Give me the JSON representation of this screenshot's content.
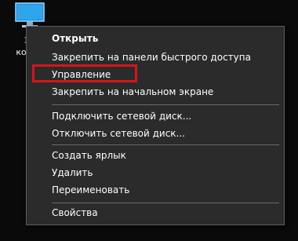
{
  "desktop": {
    "icon_name": "monitor-icon",
    "icon_label_line1": "Эт",
    "icon_label_line2": "компь"
  },
  "context_menu": {
    "items": [
      {
        "label": "Открыть",
        "default": true
      },
      {
        "label": "Закрепить на панели быстрого доступа"
      },
      {
        "label": "Управление",
        "highlighted": true
      },
      {
        "label": "Закрепить на начальном экране"
      },
      {
        "label": "Подключить сетевой диск..."
      },
      {
        "label": "Отключить сетевой диск..."
      },
      {
        "label": "Создать ярлык"
      },
      {
        "label": "Удалить"
      },
      {
        "label": "Переименовать"
      },
      {
        "label": "Свойства"
      }
    ]
  },
  "colors": {
    "menu_background": "#2b2b2b",
    "menu_text": "#ffffff",
    "separator": "#6a6a6a",
    "highlight_outline": "#d8141c",
    "desktop_background": "#0a0a0a"
  }
}
